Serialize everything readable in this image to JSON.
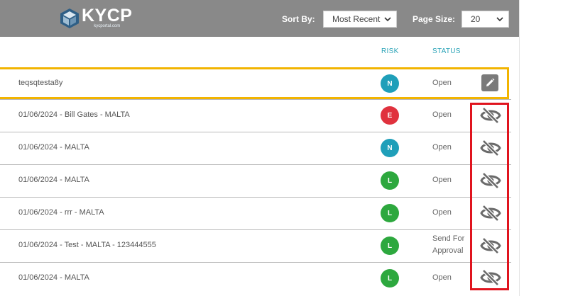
{
  "brand": {
    "name": "KYCP",
    "subtitle": "kycportal.com"
  },
  "controls": {
    "sort_label": "Sort By:",
    "sort_value": "Most Recent",
    "page_size_label": "Page Size:",
    "page_size_value": "20"
  },
  "columns": {
    "risk": "RISK",
    "status": "STATUS"
  },
  "risk_colors": {
    "N": "#1f9fb9",
    "E": "#e0323e",
    "L": "#2da83e"
  },
  "rows": [
    {
      "name": "teqsqtesta8y",
      "risk": "N",
      "status": "Open",
      "action": "edit-icon"
    },
    {
      "name": "01/06/2024 - Bill Gates - MALTA",
      "risk": "E",
      "status": "Open",
      "action": "eye-slash-icon"
    },
    {
      "name": "01/06/2024 - MALTA",
      "risk": "N",
      "status": "Open",
      "action": "eye-slash-icon"
    },
    {
      "name": "01/06/2024 - MALTA",
      "risk": "L",
      "status": "Open",
      "action": "eye-slash-icon"
    },
    {
      "name": "01/06/2024 - rrr - MALTA",
      "risk": "L",
      "status": "Open",
      "action": "eye-slash-icon"
    },
    {
      "name": "01/06/2024 - Test - MALTA - 123444555",
      "risk": "L",
      "status_lines": [
        "Send For",
        "Approval"
      ],
      "action": "eye-slash-icon"
    },
    {
      "name": "01/06/2024 - MALTA",
      "risk": "L",
      "status": "Open",
      "action": "eye-slash-icon"
    }
  ],
  "highlight": {
    "selected_row_color": "#f2b400",
    "action_group_color": "#e0141e"
  }
}
